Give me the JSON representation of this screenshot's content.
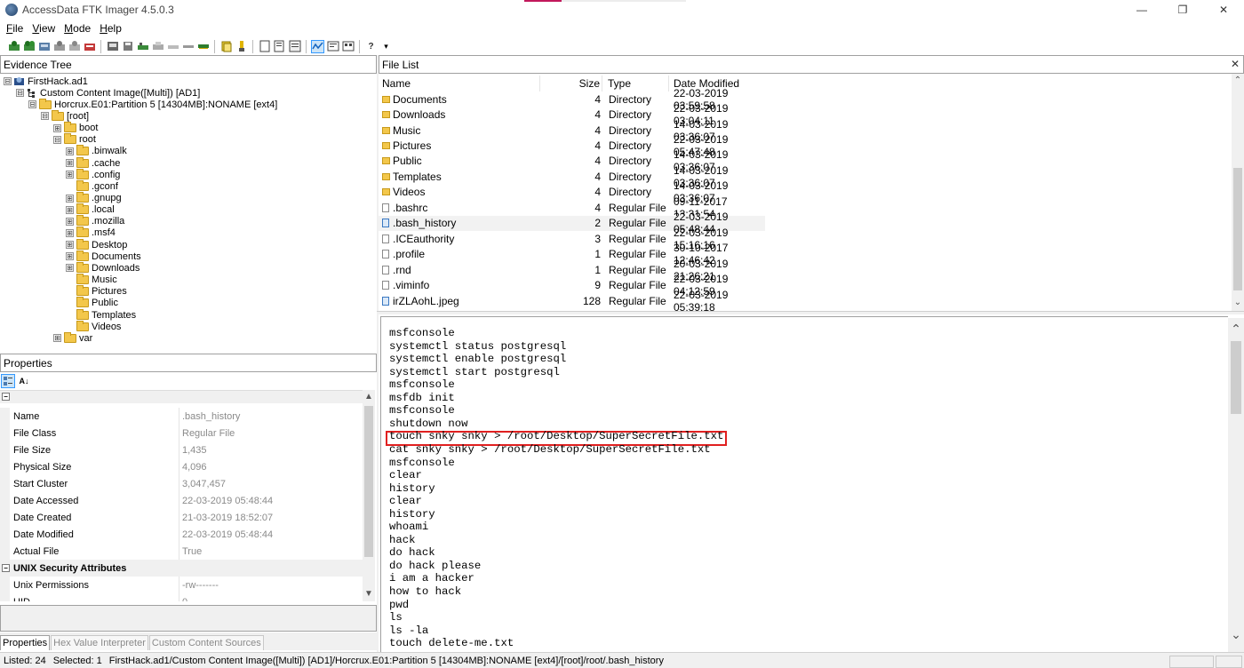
{
  "window": {
    "title": "AccessData FTK Imager 4.5.0.3",
    "minimize": "—",
    "restore": "❐",
    "close": "✕"
  },
  "menu": [
    {
      "label": "File",
      "accel": "F",
      "rest": "ile"
    },
    {
      "label": "View",
      "accel": "V",
      "rest": "iew"
    },
    {
      "label": "Mode",
      "accel": "M",
      "rest": "ode"
    },
    {
      "label": "Help",
      "accel": "H",
      "rest": "elp"
    }
  ],
  "evidence_tree": {
    "header": "Evidence Tree",
    "nodes": [
      {
        "label": "FirstHack.ad1",
        "depth": 0,
        "exp": "⊟",
        "icon": "evidence"
      },
      {
        "label": "Custom Content Image([Multi]) [AD1]",
        "depth": 1,
        "exp": "⊟",
        "icon": "tree"
      },
      {
        "label": "Horcrux.E01:Partition 5 [14304MB]:NONAME [ext4]",
        "depth": 2,
        "exp": "⊟",
        "icon": "folder"
      },
      {
        "label": "[root]",
        "depth": 3,
        "exp": "⊟",
        "icon": "folder"
      },
      {
        "label": "boot",
        "depth": 4,
        "exp": "⊞",
        "icon": "folder"
      },
      {
        "label": "root",
        "depth": 4,
        "exp": "⊟",
        "icon": "folder"
      },
      {
        "label": ".binwalk",
        "depth": 5,
        "exp": "⊞",
        "icon": "folder"
      },
      {
        "label": ".cache",
        "depth": 5,
        "exp": "⊞",
        "icon": "folder"
      },
      {
        "label": ".config",
        "depth": 5,
        "exp": "⊞",
        "icon": "folder"
      },
      {
        "label": ".gconf",
        "depth": 5,
        "exp": "",
        "icon": "folder"
      },
      {
        "label": ".gnupg",
        "depth": 5,
        "exp": "⊞",
        "icon": "folder"
      },
      {
        "label": ".local",
        "depth": 5,
        "exp": "⊞",
        "icon": "folder"
      },
      {
        "label": ".mozilla",
        "depth": 5,
        "exp": "⊞",
        "icon": "folder"
      },
      {
        "label": ".msf4",
        "depth": 5,
        "exp": "⊞",
        "icon": "folder"
      },
      {
        "label": "Desktop",
        "depth": 5,
        "exp": "⊞",
        "icon": "folder"
      },
      {
        "label": "Documents",
        "depth": 5,
        "exp": "⊞",
        "icon": "folder"
      },
      {
        "label": "Downloads",
        "depth": 5,
        "exp": "⊞",
        "icon": "folder"
      },
      {
        "label": "Music",
        "depth": 5,
        "exp": "",
        "icon": "folder"
      },
      {
        "label": "Pictures",
        "depth": 5,
        "exp": "",
        "icon": "folder"
      },
      {
        "label": "Public",
        "depth": 5,
        "exp": "",
        "icon": "folder"
      },
      {
        "label": "Templates",
        "depth": 5,
        "exp": "",
        "icon": "folder"
      },
      {
        "label": "Videos",
        "depth": 5,
        "exp": "",
        "icon": "folder"
      },
      {
        "label": "var",
        "depth": 4,
        "exp": "⊞",
        "icon": "folder"
      }
    ]
  },
  "properties": {
    "header": "Properties",
    "rows": [
      {
        "name": "Name",
        "value": ".bash_history"
      },
      {
        "name": "File Class",
        "value": "Regular File"
      },
      {
        "name": "File Size",
        "value": "1,435"
      },
      {
        "name": "Physical Size",
        "value": "4,096"
      },
      {
        "name": "Start Cluster",
        "value": "3,047,457"
      },
      {
        "name": "Date Accessed",
        "value": "22-03-2019 05:48:44"
      },
      {
        "name": "Date Created",
        "value": "21-03-2019 18:52:07"
      },
      {
        "name": "Date Modified",
        "value": "22-03-2019 05:48:44"
      },
      {
        "name": "Actual File",
        "value": "True"
      }
    ],
    "category": "UNIX Security Attributes",
    "rows2": [
      {
        "name": "Unix Permissions",
        "value": "-rw-------"
      },
      {
        "name": "UID",
        "value": "0"
      }
    ],
    "tabs": [
      "Properties",
      "Hex Value Interpreter",
      "Custom Content Sources"
    ]
  },
  "file_list": {
    "header": "File List",
    "columns": {
      "name": "Name",
      "size": "Size",
      "type": "Type",
      "date": "Date Modified"
    },
    "rows": [
      {
        "name": "Documents",
        "size": "4",
        "type": "Directory",
        "date": "22-03-2019 03:59:58",
        "kind": "folder"
      },
      {
        "name": "Downloads",
        "size": "4",
        "type": "Directory",
        "date": "22-03-2019 03:04:11",
        "kind": "folder"
      },
      {
        "name": "Music",
        "size": "4",
        "type": "Directory",
        "date": "14-03-2019 03:36:07",
        "kind": "folder"
      },
      {
        "name": "Pictures",
        "size": "4",
        "type": "Directory",
        "date": "22-03-2019 05:47:48",
        "kind": "folder"
      },
      {
        "name": "Public",
        "size": "4",
        "type": "Directory",
        "date": "14-03-2019 03:36:07",
        "kind": "folder"
      },
      {
        "name": "Templates",
        "size": "4",
        "type": "Directory",
        "date": "14-03-2019 03:36:07",
        "kind": "folder"
      },
      {
        "name": "Videos",
        "size": "4",
        "type": "Directory",
        "date": "14-03-2019 03:36:07",
        "kind": "folder"
      },
      {
        "name": ".bashrc",
        "size": "4",
        "type": "Regular File",
        "date": "09-11-2017 13:31:54",
        "kind": "file"
      },
      {
        "name": ".bash_history",
        "size": "2",
        "type": "Regular File",
        "date": "22-03-2019 05:48:44",
        "kind": "file-sel"
      },
      {
        "name": ".ICEauthority",
        "size": "3",
        "type": "Regular File",
        "date": "22-03-2019 15:16:16",
        "kind": "file"
      },
      {
        "name": ".profile",
        "size": "1",
        "type": "Regular File",
        "date": "30-10-2017 12:46:42",
        "kind": "file"
      },
      {
        "name": ".rnd",
        "size": "1",
        "type": "Regular File",
        "date": "20-03-2019 21:26:21",
        "kind": "file"
      },
      {
        "name": ".viminfo",
        "size": "9",
        "type": "Regular File",
        "date": "22-03-2019 04:12:59",
        "kind": "file"
      },
      {
        "name": "irZLAohL.jpeg",
        "size": "128",
        "type": "Regular File",
        "date": "22-03-2019 05:39:18",
        "kind": "image"
      }
    ]
  },
  "viewer_lines": [
    "msfconsole",
    "systemctl status postgresql",
    "systemctl enable postgresql",
    "systemctl start postgresql",
    "msfconsole",
    "msfdb init",
    "msfconsole",
    "shutdown now",
    "touch snky snky > /root/Desktop/SuperSecretFile.txt",
    "cat snky snky > /root/Desktop/SuperSecretFile.txt",
    "msfconsole",
    "clear",
    "history",
    "clear",
    "history",
    "whoami",
    "hack",
    "do hack",
    "do hack please",
    "i am a hacker",
    "how to hack",
    "pwd",
    "ls",
    "ls -la",
    "touch delete-me.txt"
  ],
  "status": {
    "listed": "Listed: 24",
    "selected": "Selected: 1",
    "path": "FirstHack.ad1/Custom Content Image([Multi]) [AD1]/Horcrux.E01:Partition 5 [14304MB]:NONAME [ext4]/[root]/root/.bash_history"
  },
  "toolbar_icons": [
    "add-evidence",
    "add-all",
    "image-mount",
    "remove-evidence",
    "remove-all",
    "create-image",
    "export-disk",
    "capture-memory",
    "obtain-protected",
    "detect-encryption",
    "export-files",
    "hash-list",
    "verify",
    "view-file",
    "view-text",
    "view-hex",
    "auto-detect",
    "text-mode",
    "hex-mode",
    "help"
  ]
}
